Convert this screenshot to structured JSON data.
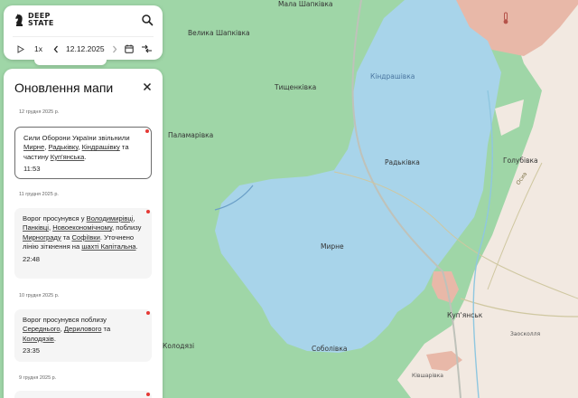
{
  "app": {
    "logo_line1": "DEEP",
    "logo_line2": "STATE"
  },
  "controls": {
    "speed": "1x",
    "date": "12.12.2025"
  },
  "panel": {
    "title": "Оновлення мапи"
  },
  "updates": [
    {
      "date": "12 грудня 2025 р.",
      "parts": [
        {
          "t": "Сили Оборони України звільнили "
        },
        {
          "t": "Мирне",
          "link": true
        },
        {
          "t": ", "
        },
        {
          "t": "Радьківку",
          "link": true
        },
        {
          "t": ", "
        },
        {
          "t": "Кіндрашівку",
          "link": true
        },
        {
          "t": " та частину "
        },
        {
          "t": "Куп'янська",
          "link": true
        },
        {
          "t": "."
        }
      ],
      "time": "11:53"
    },
    {
      "date": "11 грудня 2025 р.",
      "parts": [
        {
          "t": "Ворог просунувся у "
        },
        {
          "t": "Володимирівці",
          "link": true
        },
        {
          "t": ", "
        },
        {
          "t": "Панківці",
          "link": true
        },
        {
          "t": ", "
        },
        {
          "t": "Новоекономічному",
          "link": true
        },
        {
          "t": ", поблизу "
        },
        {
          "t": "Мирнограду",
          "link": true
        },
        {
          "t": " та "
        },
        {
          "t": "Софіївки",
          "link": true
        },
        {
          "t": ". Уточнено лінію зіткнення на "
        },
        {
          "t": "шахті Капітальна",
          "link": true
        },
        {
          "t": "."
        }
      ],
      "time": "22:48"
    },
    {
      "date": "10 грудня 2025 р.",
      "parts": [
        {
          "t": "Ворог просунувся поблизу "
        },
        {
          "t": "Середнього",
          "link": true
        },
        {
          "t": ", "
        },
        {
          "t": "Дерилового",
          "link": true
        },
        {
          "t": " та "
        },
        {
          "t": "Колодязів",
          "link": true
        },
        {
          "t": "."
        }
      ],
      "time": "23:35"
    },
    {
      "date": "9 грудня 2025 р.",
      "parts": [],
      "time": ""
    }
  ],
  "map": {
    "places": [
      "Мала Шапківка",
      "Велика Шапківка",
      "Тищенківка",
      "Кіндрашівка",
      "Паламарівка",
      "Радьківка",
      "Голубівка",
      "Мирне",
      "Куп'янськ",
      "Соболівка",
      "Колодязі",
      "Осиа",
      "Заосколля",
      "Ківшарівка"
    ],
    "colors": {
      "free": "#9fd6a7",
      "liberated": "#a8d4ea",
      "occupied": "#e8b8a8",
      "grey": "#f2e9e1",
      "accent_red": "#e53935"
    }
  }
}
